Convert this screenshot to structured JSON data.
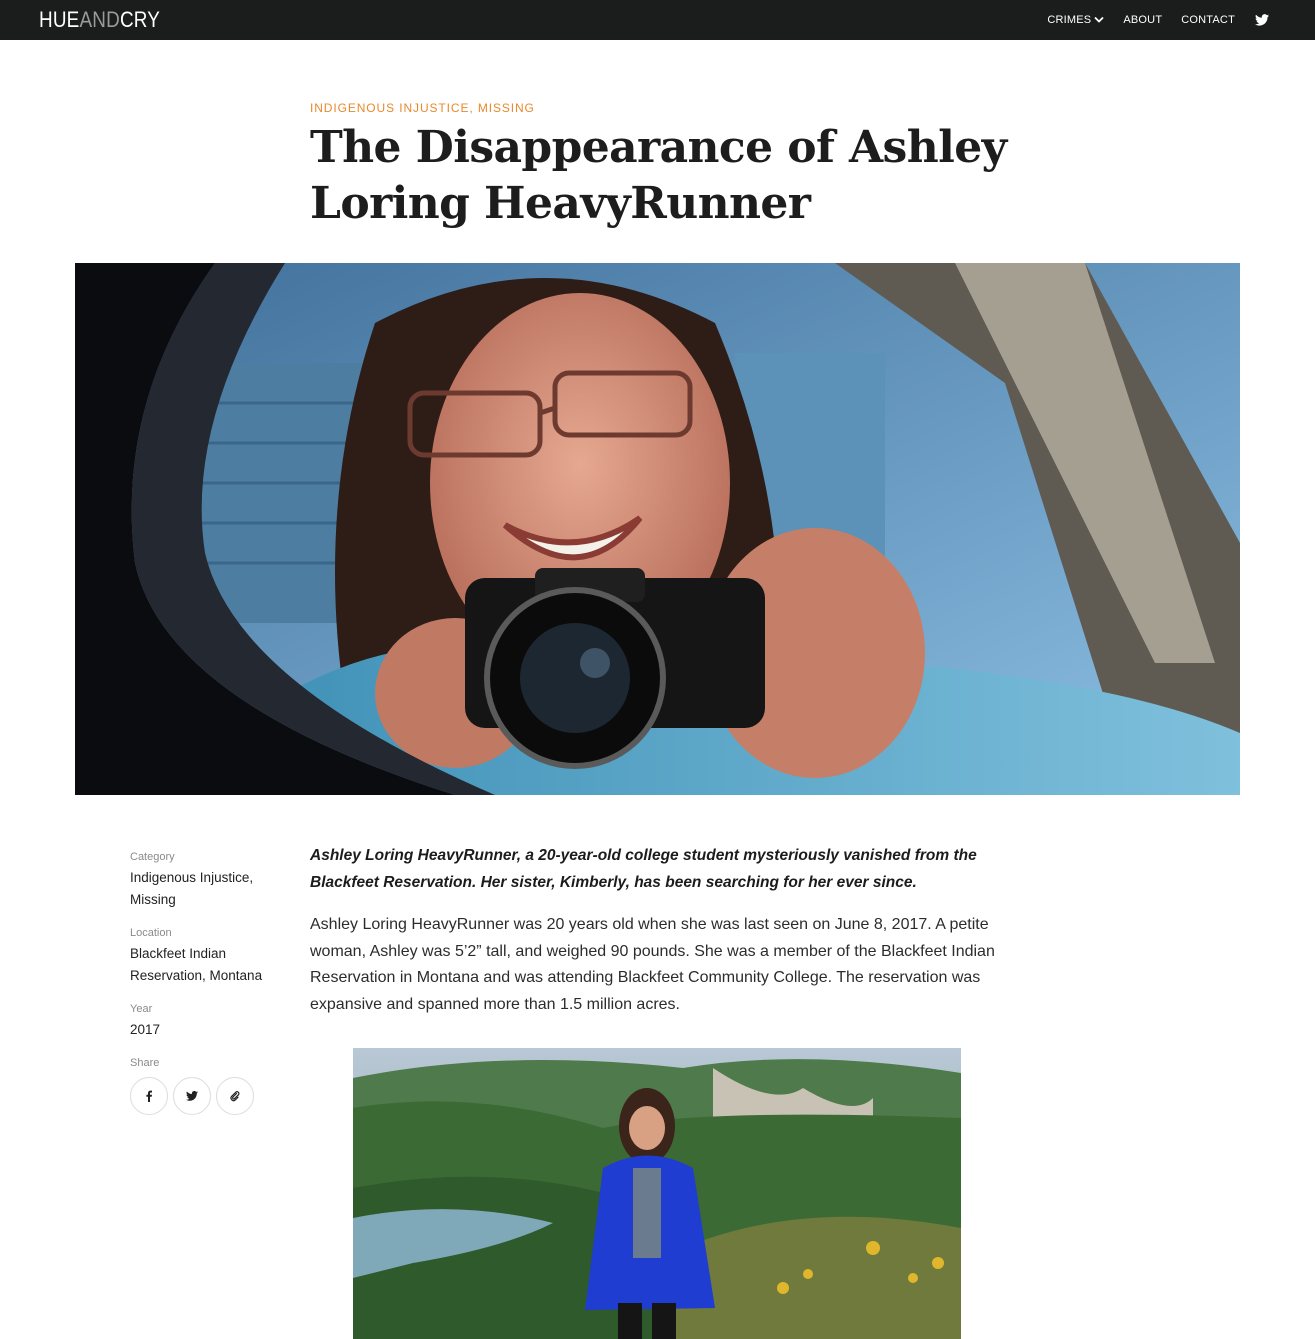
{
  "site": {
    "logo_hue": "HUE",
    "logo_and": "AND",
    "logo_cry": "CRY"
  },
  "nav": {
    "crimes": "CRIMES",
    "about": "ABOUT",
    "contact": "CONTACT"
  },
  "article": {
    "categories": "INDIGENOUS INJUSTICE, MISSING",
    "title": "The Disappearance of Ashley Loring HeavyRunner",
    "lede": "Ashley Loring HeavyRunner, a 20-year-old college student mysteriously vanished from the Blackfeet Reservation. Her sister, Kimberly, has been searching for her ever since.",
    "paragraph_1": "Ashley Loring HeavyRunner was 20 years old when she was last seen on June 8, 2017. A petite woman, Ashley was  5’2” tall, and weighed 90 pounds. She was a member of the Blackfeet Indian Reservation in Montana and was attending Blackfeet Community College. The reservation was expansive and spanned more than 1.5 million acres."
  },
  "meta": {
    "category_label": "Category",
    "category_value": "Indigenous Injustice, Missing",
    "location_label": "Location",
    "location_value": "Blackfeet Indian Reservation, Montana",
    "year_label": "Year",
    "year_value": "2017",
    "share_label": "Share"
  },
  "icons": {
    "nav_dropdown": "chevron-down-icon",
    "social": "twitter-icon",
    "share": [
      "facebook-icon",
      "twitter-icon",
      "link-icon"
    ]
  },
  "colors": {
    "topbar": "#1b1c1c",
    "accent": "#e8892c"
  }
}
